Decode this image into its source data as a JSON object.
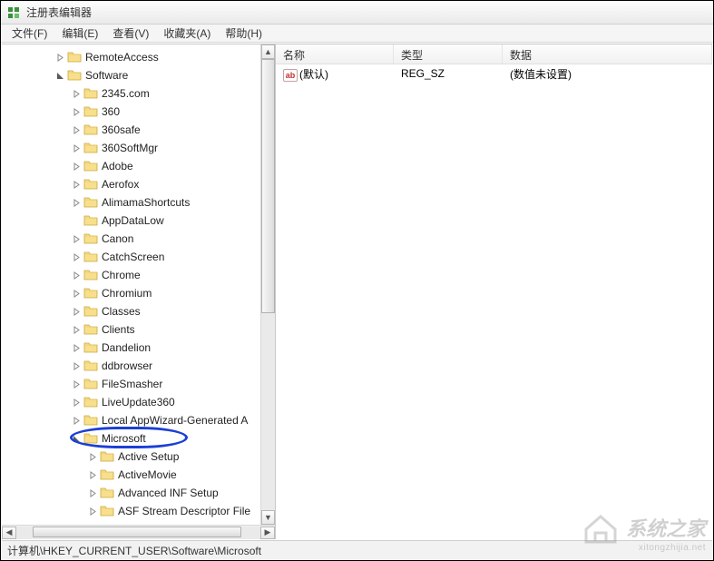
{
  "window": {
    "title": "注册表编辑器"
  },
  "menu": {
    "file": "文件(F)",
    "edit": "编辑(E)",
    "view": "查看(V)",
    "favorites": "收藏夹(A)",
    "help": "帮助(H)"
  },
  "tree": [
    {
      "indent": 3,
      "expander": "right",
      "label": "RemoteAccess"
    },
    {
      "indent": 3,
      "expander": "down",
      "label": "Software"
    },
    {
      "indent": 4,
      "expander": "right",
      "label": "2345.com"
    },
    {
      "indent": 4,
      "expander": "right",
      "label": "360"
    },
    {
      "indent": 4,
      "expander": "right",
      "label": "360safe"
    },
    {
      "indent": 4,
      "expander": "right",
      "label": "360SoftMgr"
    },
    {
      "indent": 4,
      "expander": "right",
      "label": "Adobe"
    },
    {
      "indent": 4,
      "expander": "right",
      "label": "Aerofox"
    },
    {
      "indent": 4,
      "expander": "right",
      "label": "AlimamaShortcuts"
    },
    {
      "indent": 4,
      "expander": "none",
      "label": "AppDataLow"
    },
    {
      "indent": 4,
      "expander": "right",
      "label": "Canon"
    },
    {
      "indent": 4,
      "expander": "right",
      "label": "CatchScreen"
    },
    {
      "indent": 4,
      "expander": "right",
      "label": "Chrome"
    },
    {
      "indent": 4,
      "expander": "right",
      "label": "Chromium"
    },
    {
      "indent": 4,
      "expander": "right",
      "label": "Classes"
    },
    {
      "indent": 4,
      "expander": "right",
      "label": "Clients"
    },
    {
      "indent": 4,
      "expander": "right",
      "label": "Dandelion"
    },
    {
      "indent": 4,
      "expander": "right",
      "label": "ddbrowser"
    },
    {
      "indent": 4,
      "expander": "right",
      "label": "FileSmasher"
    },
    {
      "indent": 4,
      "expander": "right",
      "label": "LiveUpdate360"
    },
    {
      "indent": 4,
      "expander": "right",
      "label": "Local AppWizard-Generated A"
    },
    {
      "indent": 4,
      "expander": "down",
      "label": "Microsoft",
      "highlighted": true
    },
    {
      "indent": 5,
      "expander": "right",
      "label": "Active Setup"
    },
    {
      "indent": 5,
      "expander": "right",
      "label": "ActiveMovie"
    },
    {
      "indent": 5,
      "expander": "right",
      "label": "Advanced INF Setup"
    },
    {
      "indent": 5,
      "expander": "right",
      "label": "ASF Stream Descriptor File"
    }
  ],
  "list": {
    "columns": {
      "name": "名称",
      "type": "类型",
      "data": "数据"
    },
    "rows": [
      {
        "name": "(默认)",
        "type": "REG_SZ",
        "data": "(数值未设置)"
      }
    ]
  },
  "statusbar": {
    "path": "计算机\\HKEY_CURRENT_USER\\Software\\Microsoft"
  },
  "watermark": {
    "brand": "系统之家",
    "url": "xitongzhijia.net"
  }
}
